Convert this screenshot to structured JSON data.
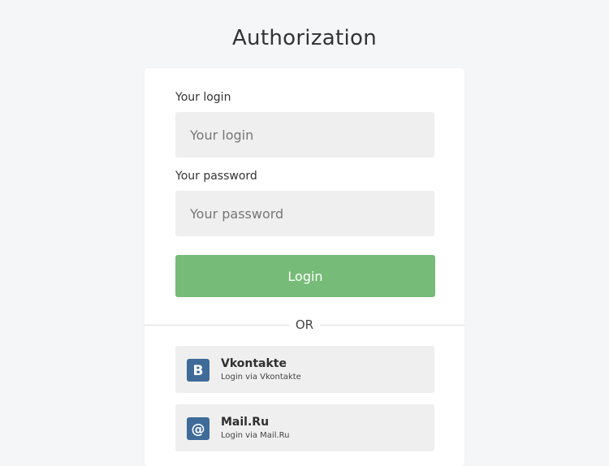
{
  "page": {
    "title": "Authorization"
  },
  "form": {
    "login_label": "Your login",
    "login_placeholder": "Your login",
    "login_value": "",
    "password_label": "Your password",
    "password_placeholder": "Your password",
    "password_value": "",
    "submit_label": "Login",
    "divider_text": "OR"
  },
  "social": [
    {
      "name": "Vkontakte",
      "subtitle": "Login via Vkontakte",
      "icon": "vk-icon",
      "icon_glyph": "B",
      "color": "#3f6b99"
    },
    {
      "name": "Mail.Ru",
      "subtitle": "Login via Mail.Ru",
      "icon": "mail-ru-icon",
      "icon_glyph": "@",
      "color": "#3f6b99"
    }
  ],
  "colors": {
    "background": "#f5f6f8",
    "card": "#ffffff",
    "input_bg": "#efefef",
    "accent": "#77bb78"
  }
}
